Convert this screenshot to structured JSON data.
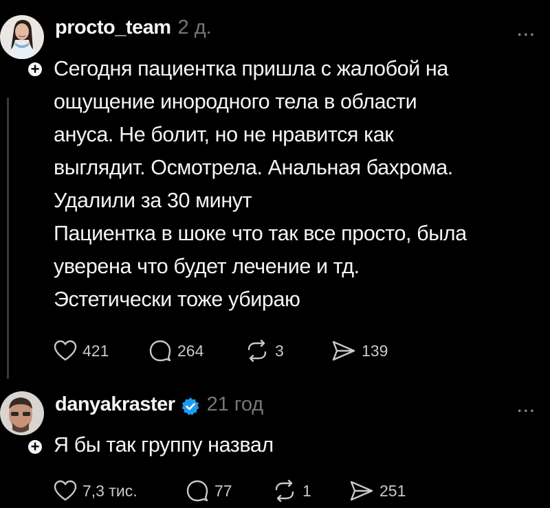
{
  "post": {
    "username": "procto_team",
    "time": "2 д.",
    "more_label": "...",
    "lines": [
      "Сегодня пациентка пришла с жалобой на",
      "ощущение инородного тела в области",
      "ануса. Не болит, но не нравится как",
      "выглядит. Осмотрела. Анальная бахрома.",
      "Удалили за 30 минут",
      "Пациентка в шоке что так все просто, была",
      "уверена что будет лечение и тд.",
      "Эстетически тоже убираю"
    ],
    "stats": {
      "likes": "421",
      "comments": "264",
      "reposts": "3",
      "shares": "139"
    }
  },
  "reply": {
    "username": "danyakraster",
    "verified": true,
    "time": "21 год",
    "more_label": "...",
    "text": "Я бы так группу назвал",
    "stats": {
      "likes": "7,3 тис.",
      "comments": "77",
      "reposts": "1",
      "shares": "251"
    }
  },
  "colors": {
    "background": "#000000",
    "text": "#f3f5f7",
    "muted": "#777777",
    "verified": "#1d9bf0"
  }
}
